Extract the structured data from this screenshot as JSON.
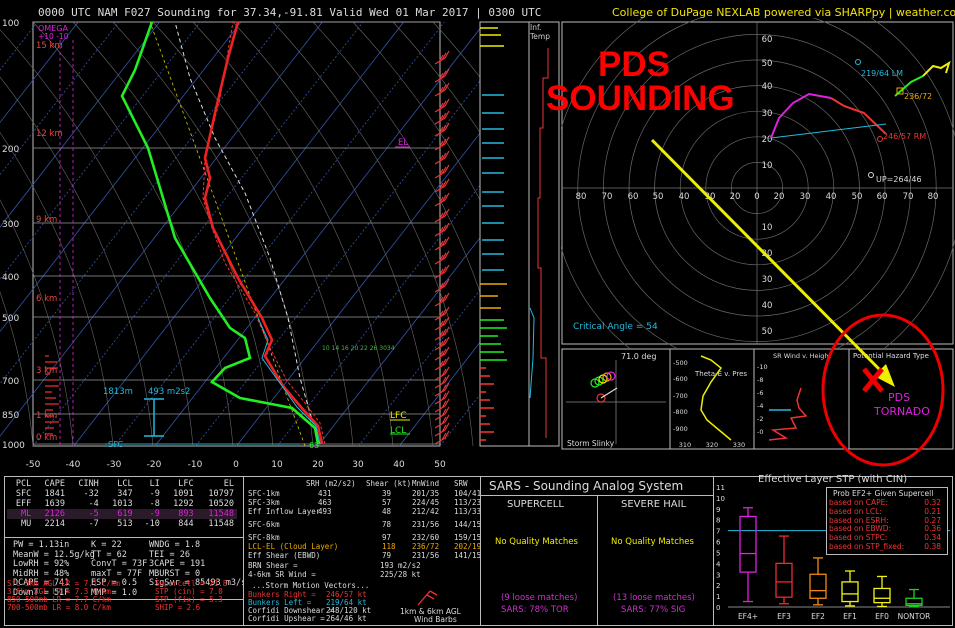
{
  "header": {
    "title": "0000 UTC NAM F027 Sounding for 37.34,-91.81 Valid  Wed 01 Mar 2017 | 0300 UTC",
    "credit": "College of DuPage NEXLAB powered via SHARPpy | weather.cod.edu"
  },
  "skewt": {
    "pressure_labels": [
      "100",
      "200",
      "300",
      "400",
      "500",
      "700",
      "850",
      "1000"
    ],
    "temp_labels": [
      "-50",
      "-40",
      "-30",
      "-20",
      "-10",
      "0",
      "10",
      "20",
      "30",
      "40",
      "50"
    ],
    "height_labels": [
      "15 km",
      "12 km",
      "9 km",
      "6 km",
      "3 km",
      "1 km",
      "0 km"
    ],
    "omega_label": "OMEGA",
    "omega_scale": "+10    -10",
    "el_label": "EL",
    "lfc_label": "LFC",
    "lcl_label": "LCL",
    "sfc_label": "SFC",
    "layer_height": "1813m",
    "layer_srh": "493 m2s2",
    "sfc_values": "63",
    "mixratio_labels": "10  14  16  20 22 26 3034"
  },
  "inflow": {
    "label1": "Inf.",
    "label2": "Temp"
  },
  "hodograph": {
    "ring_labels": [
      "60",
      "50",
      "40",
      "30",
      "20",
      "10",
      "0",
      "10",
      "20",
      "30",
      "40",
      "50",
      "60",
      "70",
      "80"
    ],
    "lm_label": "219/64 LM",
    "rm_label": "246/57 RM",
    "up_label": "UP=264/46",
    "mean_label": "236/72",
    "critical_angle": "Critical Angle = 54"
  },
  "annotation": {
    "line1": "PDS",
    "line2": "SOUNDING",
    "haz_label1": "PDS",
    "haz_label2": "TORNADO"
  },
  "mini_panels": {
    "slinky_deg": "71.0 deg",
    "slinky_label": "Storm Slinky",
    "thetae_label": "Theta-E v. Pres",
    "thetae_xticks": [
      "310",
      "320",
      "330"
    ],
    "srwind_label": "SR Wind v. Height",
    "hazard_title": "Potential Hazard Type"
  },
  "indices": {
    "headers": [
      "PCL",
      "CAPE",
      "CINH",
      "LCL",
      "LI",
      "LFC",
      "EL"
    ],
    "rows": [
      {
        "pcl": "SFC",
        "cape": "1841",
        "cinh": "-32",
        "lcl": "347",
        "li": "-9",
        "lfc": "1091",
        "el": "10797"
      },
      {
        "pcl": "EFF",
        "cape": "1639",
        "cinh": "-4",
        "lcl": "1013",
        "li": "-8",
        "lfc": "1292",
        "el": "10520"
      },
      {
        "pcl": "ML",
        "cape": "2126",
        "cinh": "-5",
        "lcl": "619",
        "li": "-9",
        "lfc": "893",
        "el": "11548"
      },
      {
        "pcl": "MU",
        "cape": "2214",
        "cinh": "-7",
        "lcl": "513",
        "li": "-10",
        "lfc": "844",
        "el": "11548"
      }
    ],
    "misc_left": [
      "PW = 1.13in",
      "MeanW = 12.5g/kg",
      "LowRH = 92%",
      "MidRH = 48%",
      "DCAPE = 741",
      "DownT = 51F"
    ],
    "misc_mid": [
      "K = 22",
      "TT = 62",
      "ConvT = 73F",
      "maxT = 77F",
      "ESP = 0.5",
      "MMP = 1.0"
    ],
    "misc_right": [
      "WNDG = 1.8",
      "TEI = 26",
      "3CAPE = 191",
      "MBURST = 0",
      "",
      "SigSvr = 85493 m3/s3"
    ],
    "lapse": [
      "Sfc-3km AGL LR = 7.1 C/km",
      "3-6km AGL LR = 7.3 C/km",
      "850-500mb LR = 7.7 C/km",
      "700-500mb LR = 8.0 C/km"
    ],
    "composites": [
      "Supercell = 21.8",
      "STP (cin) = 7.0",
      "STP (fix) = 5.3",
      "SHIP = 2.6"
    ]
  },
  "kinematics": {
    "headers": [
      "SRH (m2/s2)",
      "Shear (kt)",
      "MnWind",
      "SRW"
    ],
    "rows": [
      {
        "layer": "SFC-1km",
        "srh": "431",
        "shear": "39",
        "mnwind": "201/35",
        "srw": "104/41"
      },
      {
        "layer": "SFC-3km",
        "srh": "463",
        "shear": "57",
        "mnwind": "224/45",
        "srw": "113/23"
      },
      {
        "layer": "Eff Inflow Layer",
        "srh": "493",
        "shear": "48",
        "mnwind": "212/42",
        "srw": "113/33"
      },
      {
        "layer": "SFC-6km",
        "srh": "",
        "shear": "78",
        "mnwind": "231/56",
        "srw": "144/15"
      },
      {
        "layer": "SFC-8km",
        "srh": "",
        "shear": "97",
        "mnwind": "232/60",
        "srw": "159/15"
      },
      {
        "layer": "LCL-EL (Cloud Layer)",
        "srh": "",
        "shear": "118",
        "mnwind": "236/72",
        "srw": "202/19"
      },
      {
        "layer": "Eff Shear (EBWD)",
        "srh": "",
        "shear": "79",
        "mnwind": "231/56",
        "srw": "141/15"
      }
    ],
    "brn": "BRN Shear =",
    "brn_val": "193 m2/s2",
    "sr46": "4-6km SR Wind =",
    "sr46_val": "225/28 kt",
    "motion_title": "...Storm Motion Vectors...",
    "motion": [
      {
        "label": "Bunkers Right =",
        "val": "246/57 kt"
      },
      {
        "label": "Bunkers Left =",
        "val": "219/64 kt"
      },
      {
        "label": "Corfidi Downshear =",
        "val": "248/120 kt"
      },
      {
        "label": "Corfidi Upshear =",
        "val": "264/46 kt"
      }
    ],
    "barb_label1": "1km & 6km AGL",
    "barb_label2": "Wind Barbs"
  },
  "sars": {
    "title": "SARS - Sounding Analog System",
    "supercell": "SUPERCELL",
    "hail": "SEVERE HAIL",
    "nomatch": "No Quality Matches",
    "sc_loose": "(9 loose matches)",
    "sc_pct": "SARS: 78% TOR",
    "hail_loose": "(13 loose matches)",
    "hail_pct": "SARS: 77% SIG"
  },
  "stp": {
    "title": "Effective Layer STP (with CIN)",
    "prob_title": "Prob EF2+ Given Supercell",
    "probs": [
      {
        "label": "based on CAPE:",
        "val": "0.32"
      },
      {
        "label": "based on LCL:",
        "val": "0.21"
      },
      {
        "label": "based on ESRH:",
        "val": "0.27"
      },
      {
        "label": "based on EBWD:",
        "val": "0.36"
      },
      {
        "label": "based on STPC:",
        "val": "0.34"
      },
      {
        "label": "based on STP_fixed:",
        "val": "0.38"
      }
    ],
    "yticks": [
      "11",
      "10",
      "9",
      "8",
      "7",
      "6",
      "5",
      "4",
      "3",
      "2",
      "1",
      "0"
    ],
    "categories": [
      "EF4+",
      "EF3",
      "EF2",
      "EF1",
      "EF0",
      "NONTOR"
    ],
    "colors": {
      "ef4": "#e21ee2",
      "ef3": "#ee2b2b",
      "ef2": "#f08a14",
      "ef1": "#f2f21a",
      "ef0": "#f2f21a",
      "nontor": "#22cc22"
    }
  }
}
